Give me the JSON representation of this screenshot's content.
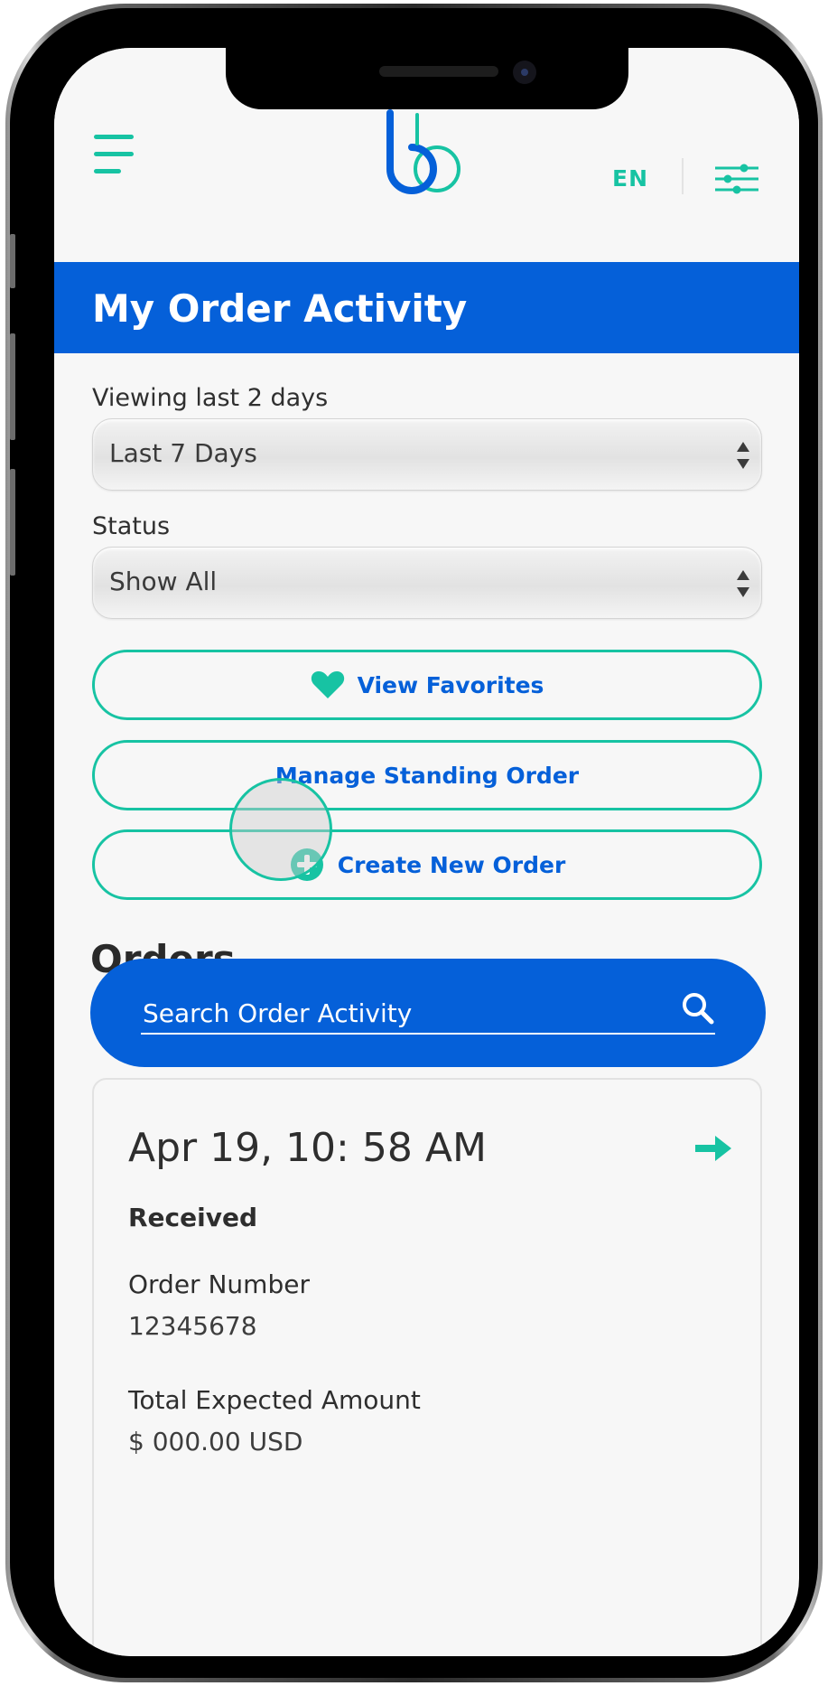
{
  "header": {
    "language": "EN"
  },
  "page": {
    "title": "My Order Activity"
  },
  "filters": {
    "range_label": "Viewing last 2 days",
    "range_selected": "Last 7 Days",
    "status_label": "Status",
    "status_selected": "Show All"
  },
  "actions": {
    "favorites_label": "View Favorites",
    "standing_order_label": "Manage Standing Order",
    "create_order_label": "Create New Order"
  },
  "orders": {
    "heading": "Orders",
    "search_placeholder": "Search Order Activity",
    "items": [
      {
        "date": "Apr 19, 10: 58 AM",
        "status": "Received",
        "number_label": "Order Number",
        "number": "12345678",
        "amount_label": "Total Expected Amount",
        "amount": "$ 000.00 USD"
      }
    ]
  },
  "colors": {
    "brand_blue": "#0560d9",
    "accent_teal": "#17c3a3",
    "background": "#f7f7f7"
  },
  "icons": {
    "menu": "hamburger-menu-icon",
    "logo": "brand-logo",
    "filter": "sliders-icon",
    "favorite": "heart-icon",
    "create": "plus-circle-icon",
    "search": "search-icon",
    "open_order": "arrow-right-icon"
  }
}
